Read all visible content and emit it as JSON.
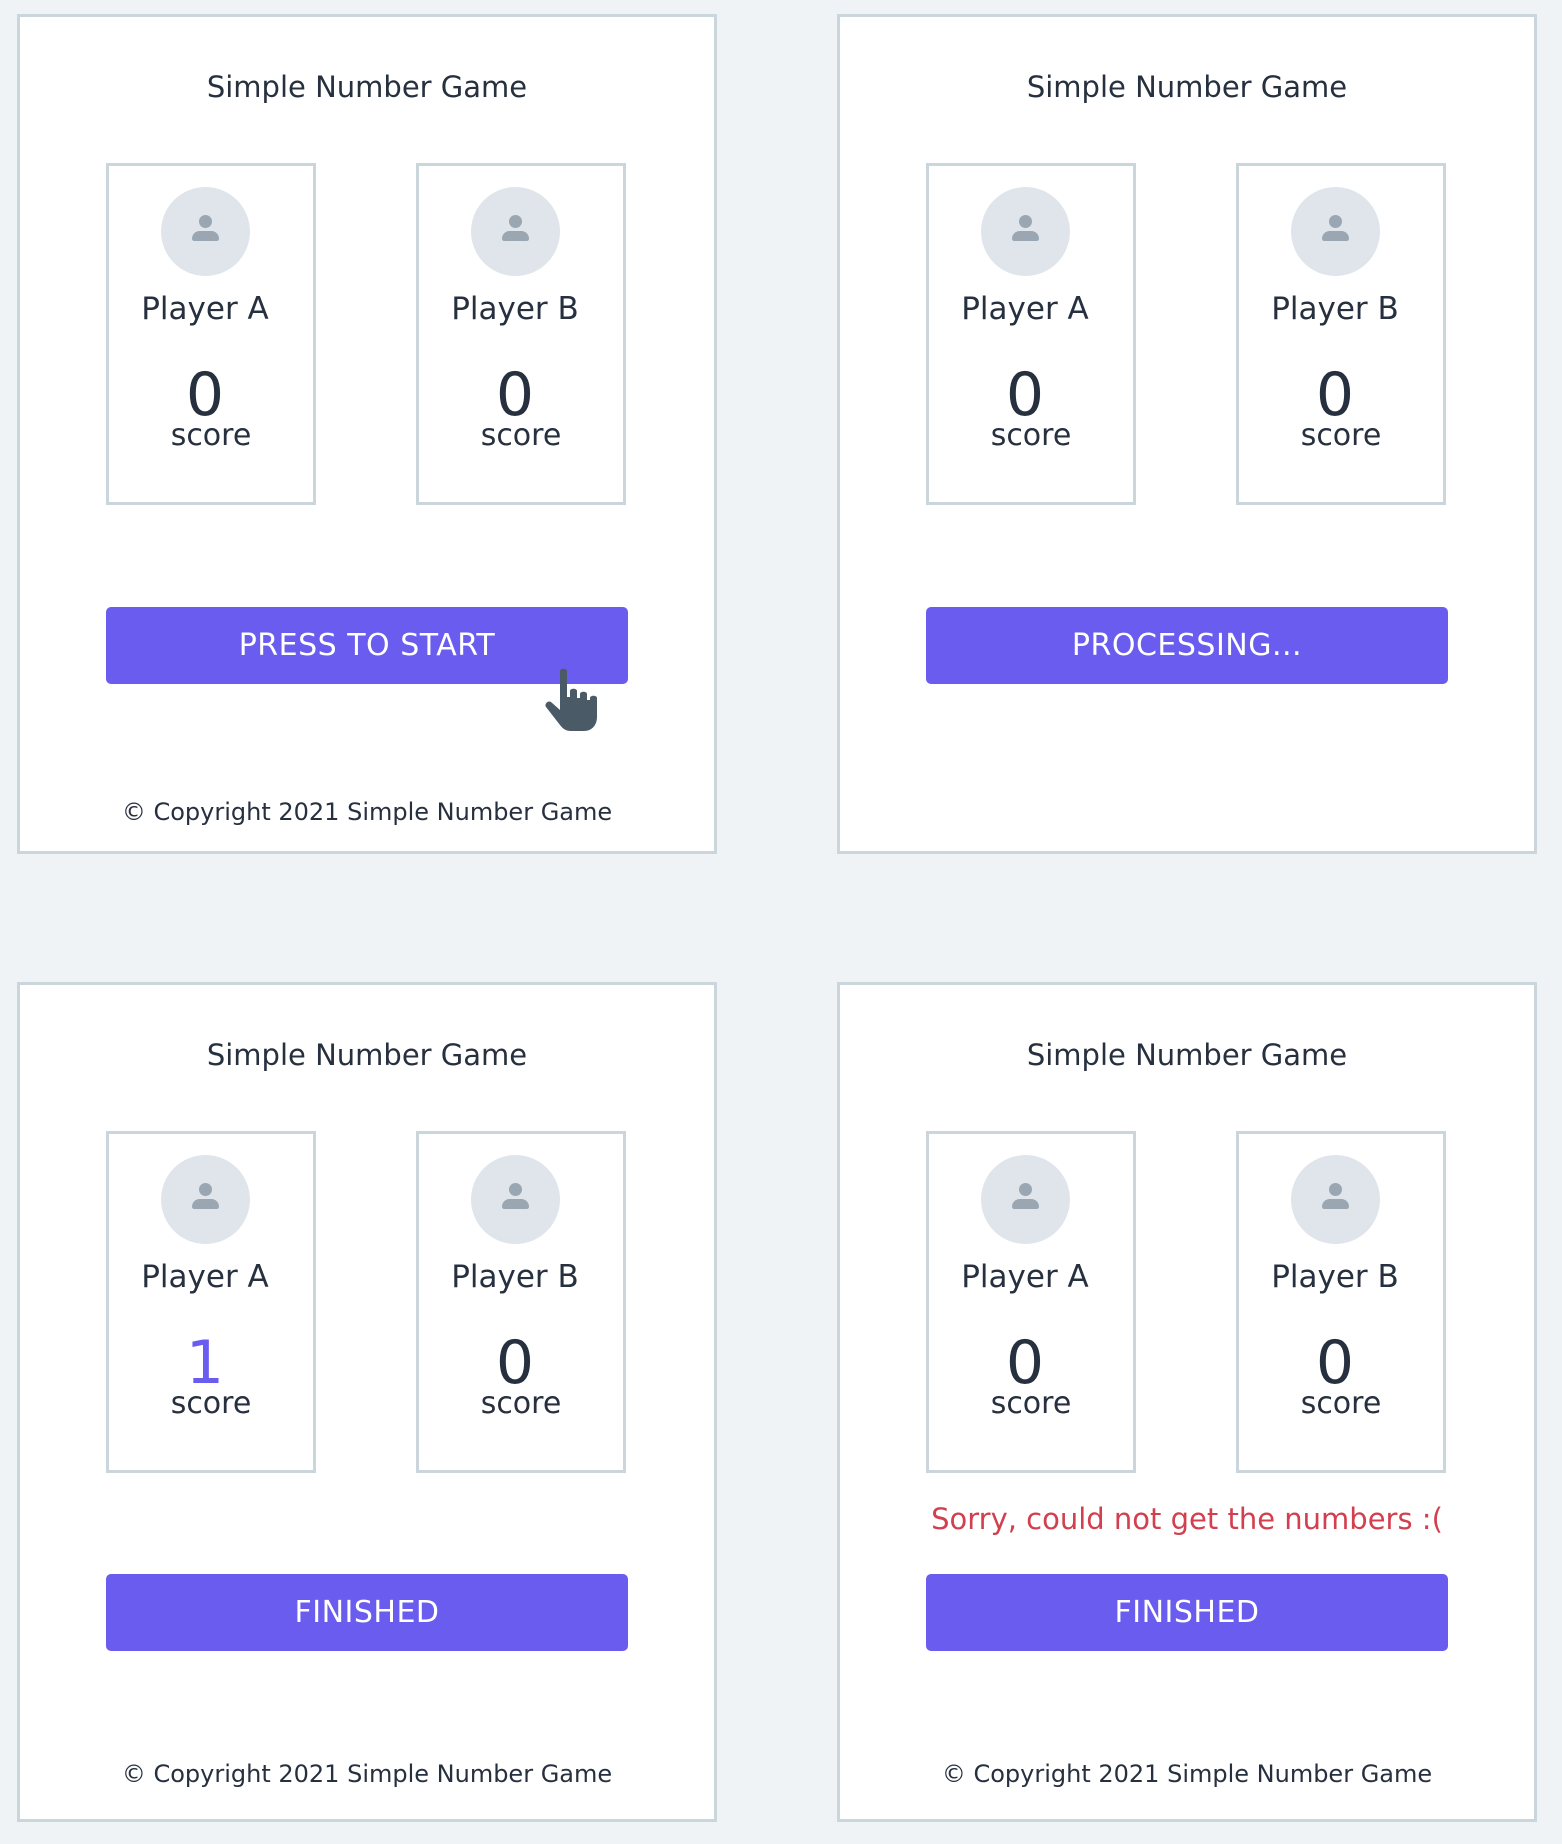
{
  "panels": [
    {
      "title": "Simple Number Game",
      "players": [
        {
          "name": "Player A",
          "score": "0",
          "score_label": "score"
        },
        {
          "name": "Player B",
          "score": "0",
          "score_label": "score"
        }
      ],
      "button_label": "PRESS TO START",
      "footer": "© Copyright 2021 Simple Number Game"
    },
    {
      "title": "Simple Number Game",
      "players": [
        {
          "name": "Player A",
          "score": "0",
          "score_label": "score"
        },
        {
          "name": "Player B",
          "score": "0",
          "score_label": "score"
        }
      ],
      "button_label": "PROCESSING..."
    },
    {
      "title": "Simple Number Game",
      "players": [
        {
          "name": "Player A",
          "score": "1",
          "score_label": "score"
        },
        {
          "name": "Player B",
          "score": "0",
          "score_label": "score"
        }
      ],
      "button_label": "FINISHED",
      "footer": "© Copyright 2021 Simple Number Game"
    },
    {
      "title": "Simple Number Game",
      "players": [
        {
          "name": "Player A",
          "score": "0",
          "score_label": "score"
        },
        {
          "name": "Player B",
          "score": "0",
          "score_label": "score"
        }
      ],
      "error_message": "Sorry, could not get the numbers :(",
      "button_label": "FINISHED",
      "footer": "© Copyright 2021 Simple Number Game"
    }
  ],
  "colors": {
    "background": "#eff3f6",
    "accent": "#6a5cef",
    "winner_score": "#6b5cf0",
    "error": "#d23f4f",
    "border": "#cbd5dc"
  },
  "icons": {
    "avatar": "user-avatar-icon",
    "cursor": "hand-pointer-icon"
  }
}
